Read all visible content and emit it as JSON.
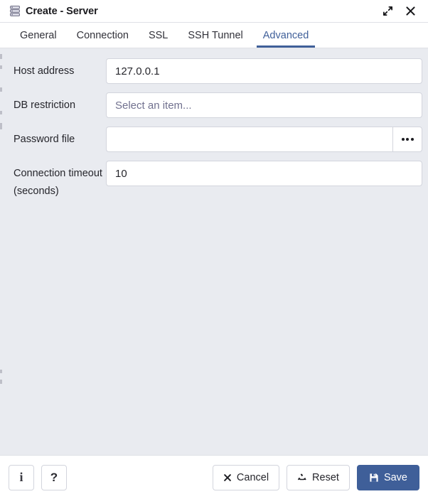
{
  "window": {
    "title": "Create - Server",
    "icon": "server-icon",
    "expand_icon": "expand-diagonal-icon",
    "close_icon": "close-icon"
  },
  "tabs": [
    {
      "label": "General",
      "active": false
    },
    {
      "label": "Connection",
      "active": false
    },
    {
      "label": "SSL",
      "active": false
    },
    {
      "label": "SSH Tunnel",
      "active": false
    },
    {
      "label": "Advanced",
      "active": true
    }
  ],
  "form": {
    "fields": [
      {
        "label": "Host address",
        "value": "127.0.0.1",
        "placeholder": "",
        "type": "text"
      },
      {
        "label": "DB restriction",
        "value": "",
        "placeholder": "Select an item...",
        "type": "multiselect"
      },
      {
        "label": "Password file",
        "value": "",
        "placeholder": "",
        "type": "file",
        "browse_label": "..."
      },
      {
        "label": "Connection timeout (seconds)",
        "value": "10",
        "placeholder": "",
        "type": "number"
      }
    ]
  },
  "footer": {
    "info_label": "i",
    "help_label": "?",
    "cancel_label": "Cancel",
    "reset_label": "Reset",
    "save_label": "Save"
  },
  "colors": {
    "accent": "#3f5f99",
    "body_bg": "#e9ebf0",
    "panel_bg": "#ffffff",
    "border": "#d3d5dd",
    "text": "#26262c",
    "placeholder": "#71718f"
  }
}
